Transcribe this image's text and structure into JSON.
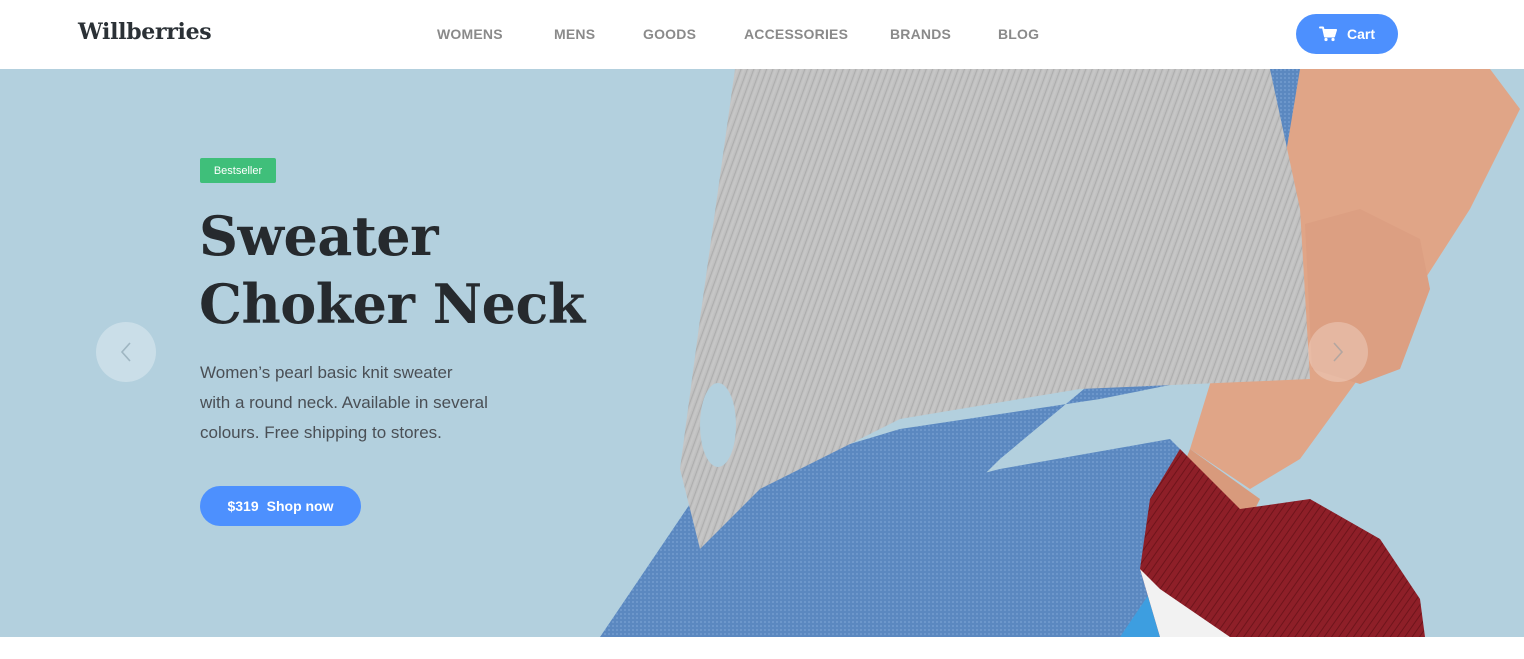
{
  "header": {
    "logo": "Willberries",
    "nav": [
      {
        "label": "WOMENS"
      },
      {
        "label": "MENS"
      },
      {
        "label": "GOODS"
      },
      {
        "label": "ACCESSORIES"
      },
      {
        "label": "BRANDS"
      },
      {
        "label": "BLOG"
      }
    ],
    "cart_label": "Cart",
    "cart_icon": "cart-icon"
  },
  "hero": {
    "badge": "Bestseller",
    "title_line1": "Sweater",
    "title_line2": "Choker Neck",
    "description_line1": "Women’s pearl basic knit sweater",
    "description_line2": "with a round neck. Available in several",
    "description_line3": "colours. Free shipping to stores.",
    "price": "$319",
    "shop_label": "Shop now",
    "prev_icon": "chevron-left-icon",
    "next_icon": "chevron-right-icon"
  },
  "colors": {
    "accent": "#4d90fe",
    "badge": "#3fbf7a",
    "hero_bg": "#b3d0de",
    "title": "#262a2e"
  }
}
